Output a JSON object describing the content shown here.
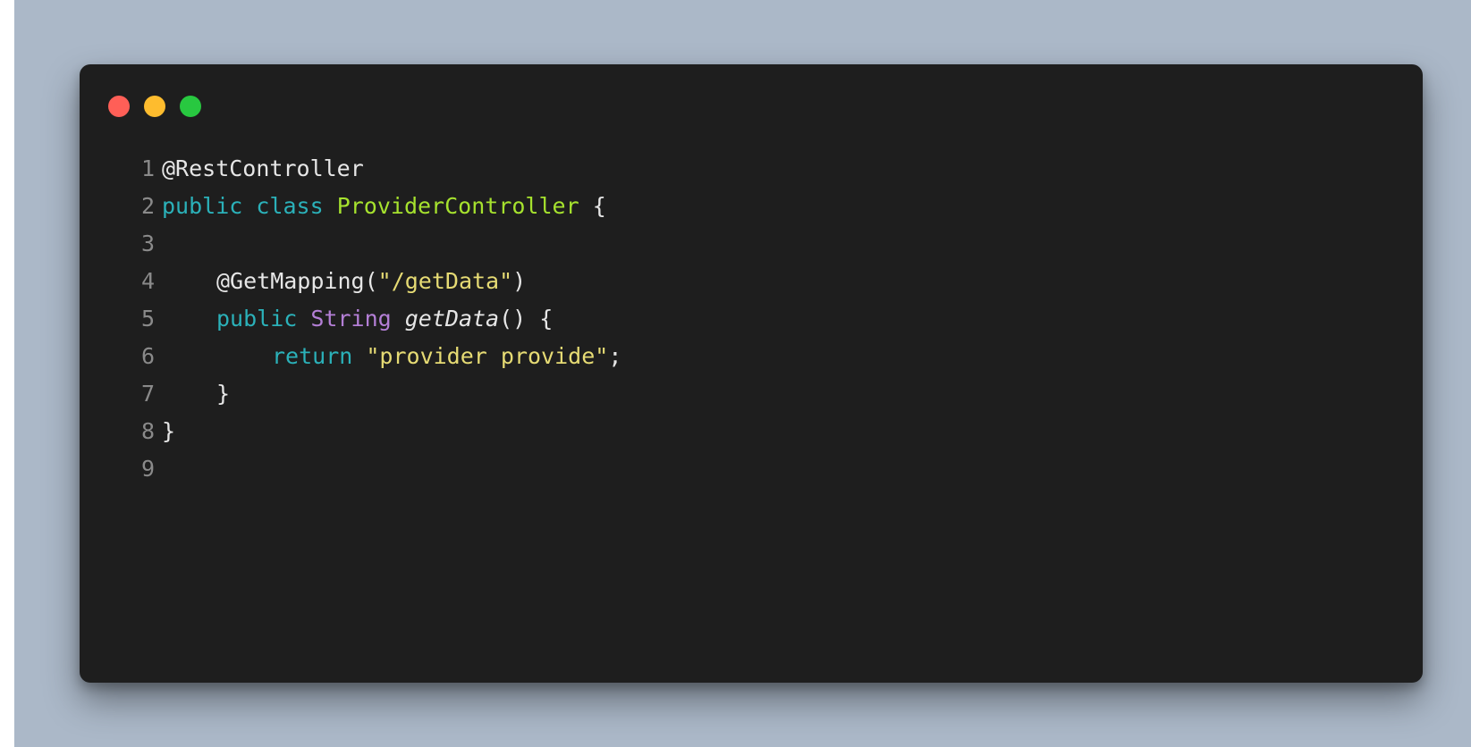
{
  "colors": {
    "background": "#abb8c8",
    "window": "#1e1e1e",
    "keyword": "#2bb1b9",
    "class_name": "#a6e22e",
    "type": "#b47fd6",
    "string": "#e6db74",
    "text": "#e6e6e6",
    "line_number": "#8a8a8a"
  },
  "window_controls": [
    {
      "name": "close-dot",
      "color": "#ff5f57"
    },
    {
      "name": "minimize-dot",
      "color": "#febc2e"
    },
    {
      "name": "maximize-dot",
      "color": "#28c840"
    }
  ],
  "code": {
    "language": "java",
    "line_numbers": [
      "1",
      "2",
      "3",
      "4",
      "5",
      "6",
      "7",
      "8",
      "9"
    ],
    "lines": {
      "l1": {
        "annotation": "@RestController"
      },
      "l2": {
        "kw1": "public",
        "kw2": "class",
        "class_name": "ProviderController",
        "brace": "{"
      },
      "l4": {
        "annotation": "@GetMapping",
        "open": "(",
        "string": "\"/getData\"",
        "close": ")"
      },
      "l5": {
        "kw": "public",
        "type": "String",
        "method": "getData",
        "parens": "()",
        "brace": "{"
      },
      "l6": {
        "kw": "return",
        "string": "\"provider provide\"",
        "semi": ";"
      },
      "l7": {
        "brace": "}"
      },
      "l8": {
        "brace": "}"
      }
    }
  }
}
